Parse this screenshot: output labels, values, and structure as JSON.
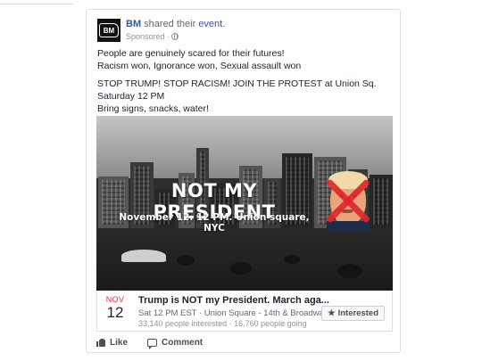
{
  "post": {
    "avatar_text": "BM",
    "page_name": "BM",
    "action_text": " shared their ",
    "event_link": "event",
    "action_end": ".",
    "sponsored": "Sponsored ·",
    "text_lines": [
      "People are genuinely scared for their futures!",
      "Racism won, Ignorance won, Sexual assault won",
      "STOP TRUMP! STOP RACISM! JOIN THE PROTEST at Union Sq.",
      "Saturday 12 PM",
      "Bring signs, snacks, water!"
    ]
  },
  "media": {
    "headline": "NOT MY PRESIDENT",
    "subhead": "November 12. 12 PM. Union square, NYC"
  },
  "event": {
    "month": "NOV",
    "day": "12",
    "title": "Trump is NOT my President. March aga...",
    "place": "Sat 12 PM EST · Union Square - 14th & Broadwa...",
    "stats": "33,140 people interested · 16,760 people going",
    "interested_label": "Interested"
  },
  "actions": {
    "like_label": "Like",
    "comment_label": "Comment"
  },
  "colors": {
    "link": "#365899",
    "month": "#f02849",
    "cross": "#e0262b"
  }
}
